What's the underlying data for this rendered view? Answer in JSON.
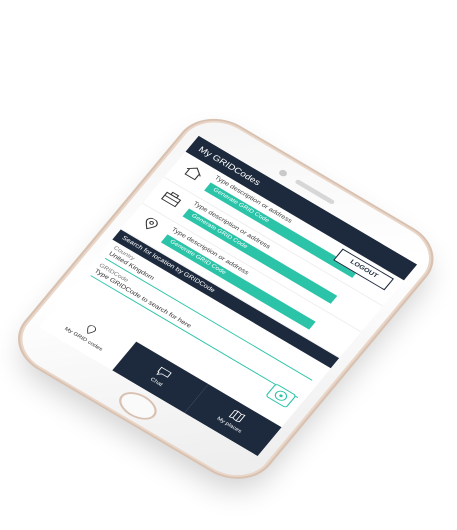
{
  "app": {
    "title": "My GRIDCodes",
    "logout_label": "LOGOUT"
  },
  "places": [
    {
      "icon": "home-icon",
      "placeholder": "Type description or address",
      "button": "Generate GRID Code"
    },
    {
      "icon": "briefcase-icon",
      "placeholder": "Type description or address",
      "button": "Generate GRID Code"
    },
    {
      "icon": "map-pin-icon",
      "placeholder": "Type description or address",
      "button": "Generate GRID Code"
    }
  ],
  "search": {
    "header": "Search for location by GRIDCode",
    "country_label": "Country",
    "country_value": "United Kingdom",
    "gridcode_label": "GRIDCode",
    "gridcode_placeholder": "Type GRIDCode to search for here"
  },
  "tabs": [
    {
      "icon": "map-pin-icon",
      "label": "My GRID codes"
    },
    {
      "icon": "chat-icon",
      "label": "Chat"
    },
    {
      "icon": "map-icon",
      "label": "My places"
    }
  ],
  "colors": {
    "navy": "#1d2a3d",
    "teal": "#2bc4a8",
    "phone_gold": "#d8c1b0"
  }
}
